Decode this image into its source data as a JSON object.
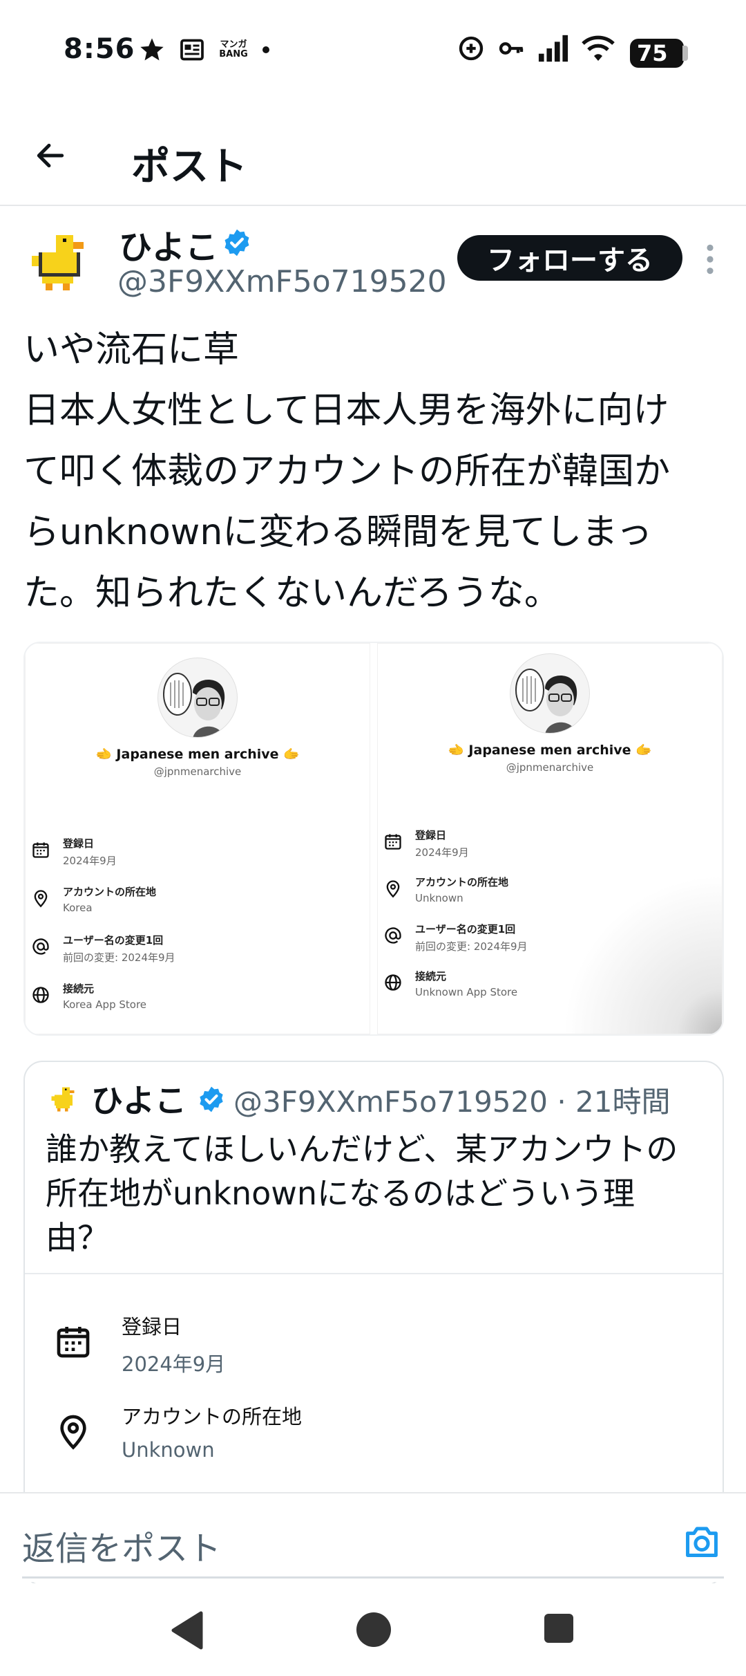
{
  "status_bar": {
    "time": "8:56",
    "left_icons": [
      "star-icon",
      "news-icon",
      "manga-bang-icon",
      "dot-icon"
    ],
    "manga_label": "マンガ BANG",
    "right_icons": [
      "data-saver-icon",
      "key-icon",
      "signal-icon",
      "wifi-icon"
    ],
    "battery": "75"
  },
  "header": {
    "title": "ポスト"
  },
  "post": {
    "author_name": "ひよこ",
    "author_handle": "@3F9XXmF5o719520",
    "follow_label": "フォローする",
    "text": "いや流石に草\n日本人女性として日本人男を海外に向け\nて叩く体裁のアカウントの所在が韓国か\nらunknownに変わる瞬間を見てしまっ\nた。知られたくないんだろうな。",
    "accent_color": "#1d9bf0"
  },
  "images": [
    {
      "profile_name": "🫲 Japanese men archive 🫱",
      "profile_handle": "@jpnmenarchive",
      "rows": [
        {
          "icon": "calendar-icon",
          "title": "登録日",
          "value": "2024年9月"
        },
        {
          "icon": "location-icon",
          "title": "アカウントの所在地",
          "value": "Korea"
        },
        {
          "icon": "at-icon",
          "title": "ユーザー名の変更1回",
          "value": "前回の変更: 2024年9月"
        },
        {
          "icon": "globe-icon",
          "title": "接続元",
          "value": "Korea App Store"
        }
      ]
    },
    {
      "profile_name": "🫲 Japanese men archive 🫱",
      "profile_handle": "@jpnmenarchive",
      "rows": [
        {
          "icon": "calendar-icon",
          "title": "登録日",
          "value": "2024年9月"
        },
        {
          "icon": "location-icon",
          "title": "アカウントの所在地",
          "value": "Unknown"
        },
        {
          "icon": "at-icon",
          "title": "ユーザー名の変更1回",
          "value": "前回の変更: 2024年9月"
        },
        {
          "icon": "globe-icon",
          "title": "接続元",
          "value": "Unknown App Store"
        }
      ]
    }
  ],
  "quote": {
    "author_name": "ひよこ",
    "author_handle": "@3F9XXmF5o719520",
    "time_ago": "21時間",
    "handle_line": "@3F9XXmF5o719520 · 21時間",
    "text": "誰か教えてほしいんだけど、某アカンウトの\n所在地がunknownになるのはどういう理\n由？",
    "rows": [
      {
        "icon": "calendar-icon",
        "title": "登録日",
        "value": "2024年9月"
      },
      {
        "icon": "location-icon",
        "title": "アカウントの所在地",
        "value": "Unknown"
      }
    ]
  },
  "reply": {
    "placeholder": "返信をポスト"
  },
  "nav": {
    "icons": [
      "nav-back-icon",
      "nav-home-icon",
      "nav-recents-icon"
    ]
  }
}
